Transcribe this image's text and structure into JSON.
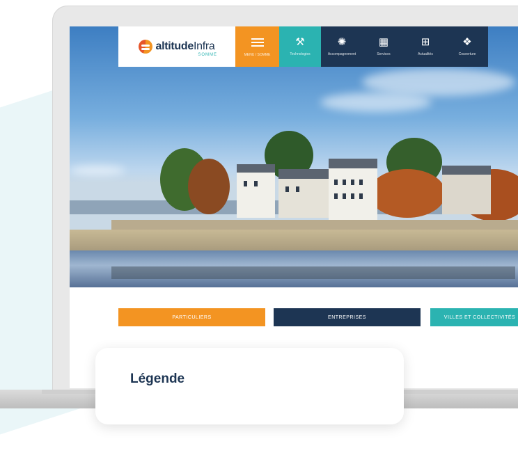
{
  "logo": {
    "brand": "altitude",
    "suffix": "Infra",
    "region": "SOMME"
  },
  "nav": [
    {
      "icon": "menu-icon",
      "label": "MENU / SOMME"
    },
    {
      "icon": "wrench-icon",
      "label": "Technologies"
    },
    {
      "icon": "satellite-icon",
      "label": "Accompagnement"
    },
    {
      "icon": "building-icon",
      "label": "Services"
    },
    {
      "icon": "network-icon",
      "label": "Actualités"
    },
    {
      "icon": "map-icon",
      "label": "Couverture"
    }
  ],
  "cta": {
    "particuliers": "PARTICULIERS",
    "entreprises": "ENTREPRISES",
    "villes": "VILLES ET COLLECTIVITÉS"
  },
  "legend": {
    "title": "Légende"
  },
  "colors": {
    "orange": "#f39422",
    "teal": "#2bb3b1",
    "navy": "#1d3553"
  }
}
